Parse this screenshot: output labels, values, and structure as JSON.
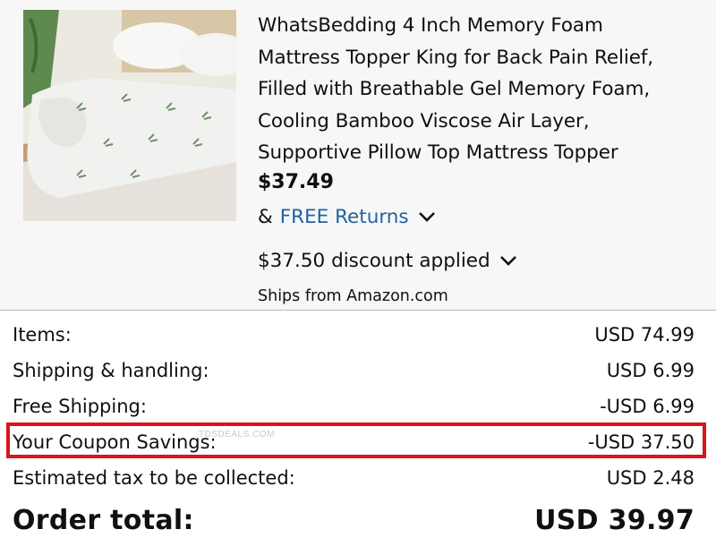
{
  "product": {
    "title_lines": [
      "WhatsBedding 4 Inch Memory Foam",
      "Mattress Topper King for Back Pain Relief,",
      "Filled with Breathable Gel Memory Foam,",
      "Cooling Bamboo Viscose Air Layer,",
      "Supportive Pillow Top Mattress Topper"
    ],
    "price": "$37.49",
    "returns_prefix": "&",
    "returns_link": "FREE Returns",
    "discount_text": "$37.50 discount applied",
    "ships_from": "Ships from Amazon.com",
    "icons": {
      "returns_expand": "chevron-down-icon",
      "discount_expand": "chevron-down-icon"
    }
  },
  "summary": {
    "rows": [
      {
        "label": "Items:",
        "value": "USD 74.99"
      },
      {
        "label": "Shipping & handling:",
        "value": "USD 6.99"
      },
      {
        "label": "Free Shipping:",
        "value": "-USD 6.99"
      },
      {
        "label": "Your Coupon Savings:",
        "value": "-USD 37.50"
      },
      {
        "label": "Estimated tax to be collected:",
        "value": "USD 2.48"
      }
    ],
    "total_label": "Order total:",
    "total_value": "USD 39.97"
  },
  "watermark": "TDSDEALS.COM",
  "colors": {
    "link": "#2162a1",
    "highlight_border": "#d9141c",
    "panel_background": "#f7f7f7",
    "text": "#0f1111"
  }
}
